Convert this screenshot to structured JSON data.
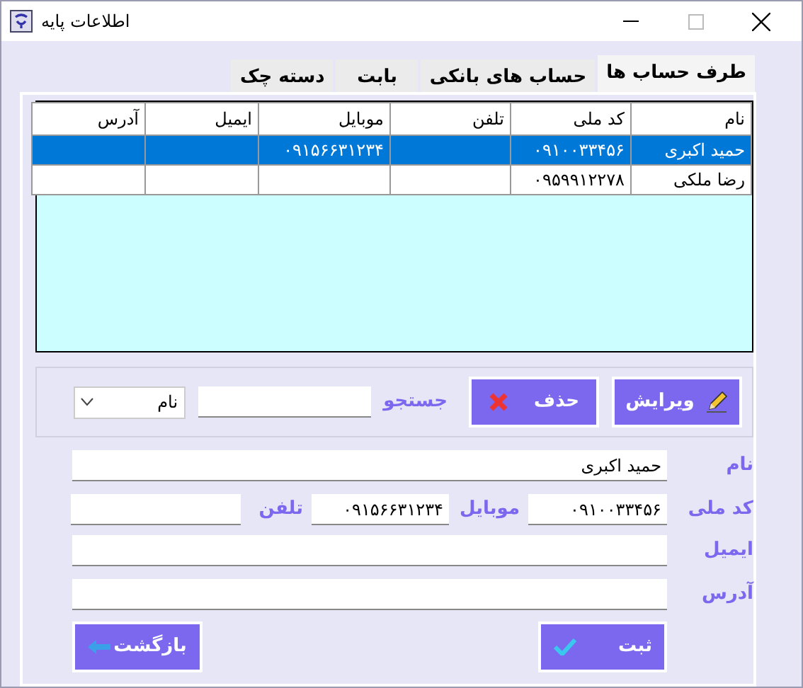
{
  "window": {
    "title": "اطلاعات پایه"
  },
  "tabs": [
    {
      "label": "طرف حساب ها",
      "selected": true
    },
    {
      "label": "حساب های بانکی",
      "selected": false
    },
    {
      "label": "بابت",
      "selected": false
    },
    {
      "label": "دسته چک",
      "selected": false
    }
  ],
  "table": {
    "columns": [
      "نام",
      "کد ملی",
      "تلفن",
      "موبایل",
      "ایمیل",
      "آدرس"
    ],
    "rows": [
      {
        "cells": [
          "حمید اکبری",
          "۰۹۱۰۰۳۳۴۵۶",
          "",
          "۰۹۱۵۶۶۳۱۲۳۴",
          "",
          ""
        ],
        "selected": true
      },
      {
        "cells": [
          "رضا ملکی",
          "۰۹۵۹۹۱۲۲۷۸",
          "",
          "",
          "",
          ""
        ],
        "selected": false
      }
    ]
  },
  "toolbar": {
    "edit_button": "ویرایش",
    "delete_button": "حذف",
    "search_label": "جستجو",
    "search_by": "نام"
  },
  "form": {
    "name_label": "نام",
    "name_value": "حمید اکبری",
    "national_code_label": "کد ملی",
    "national_code_value": "۰۹۱۰۰۳۳۴۵۶",
    "mobile_label": "موبایل",
    "mobile_value": "۰۹۱۵۶۶۳۱۲۳۴",
    "phone_label": "تلفن",
    "email_label": "ایمیل",
    "address_label": "آدرس"
  },
  "buttons": {
    "submit": "ثبت",
    "back": "بازگشت"
  }
}
